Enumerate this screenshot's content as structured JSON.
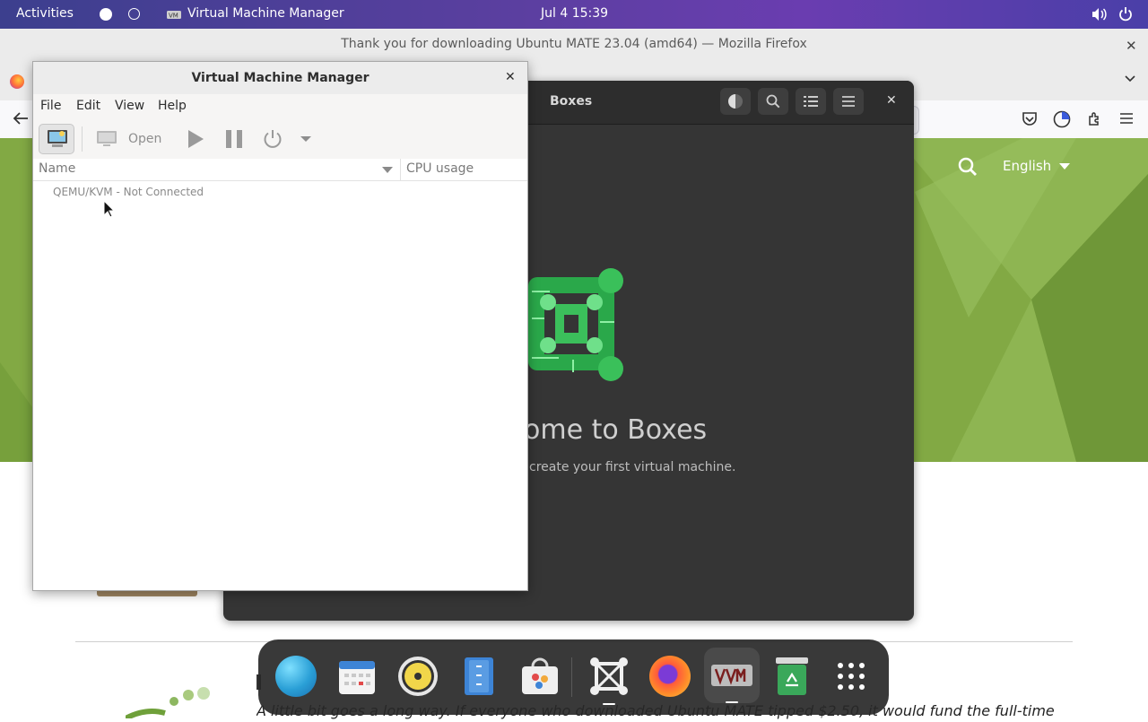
{
  "topbar": {
    "activities": "Activities",
    "app_name": "Virtual Machine Manager",
    "clock": "Jul 4  15:39"
  },
  "firefox": {
    "window_title": "Thank you for downloading Ubuntu MATE 23.04 (amd64) — Mozilla Firefox",
    "page": {
      "language": "English",
      "body_text": "A little bit goes a long way. If everyone who downloaded Ubuntu MATE tipped $2.50, it would fund the full-time"
    }
  },
  "boxes": {
    "title": "Boxes",
    "welcome": "ome to Boxes",
    "subtitle": "create your first virtual machine."
  },
  "vmm": {
    "title": "Virtual Machine Manager",
    "menu": [
      "File",
      "Edit",
      "View",
      "Help"
    ],
    "toolbar": {
      "open_label": "Open"
    },
    "columns": {
      "name": "Name",
      "cpu": "CPU usage"
    },
    "rows": [
      {
        "name": "QEMU/KVM - Not Connected"
      }
    ]
  },
  "dock": {
    "apps": [
      "web-browser-icon",
      "calendar-icon",
      "rhythmbox-icon",
      "files-icon",
      "software-icon",
      "boxes-icon",
      "firefox-icon",
      "virt-manager-icon",
      "trash-icon",
      "app-grid-icon"
    ]
  },
  "colors": {
    "topbar_start": "#3c3f8e",
    "topbar_end": "#6a3db0",
    "ubuntu_mate_green": "#82a944",
    "boxes_bg": "#353535"
  }
}
